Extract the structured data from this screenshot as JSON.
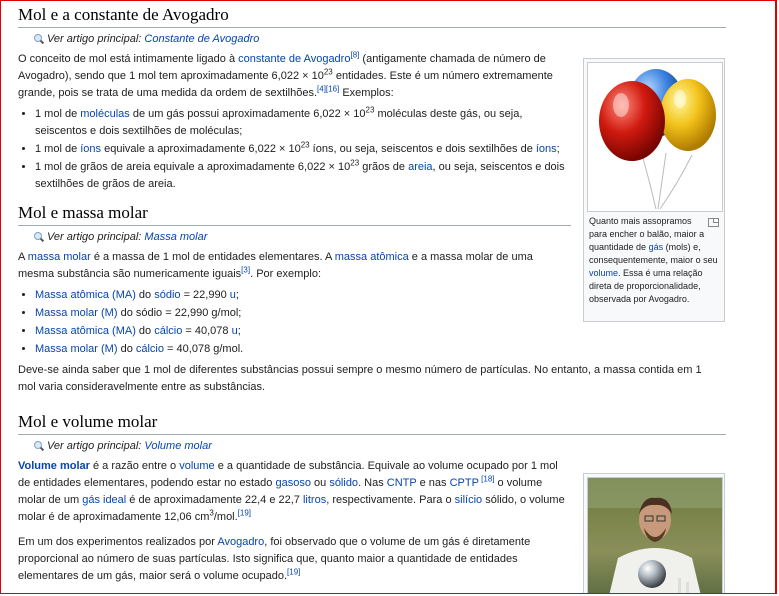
{
  "section1": {
    "heading": "Mol e a constante de Avogadro",
    "hatnote_prefix": "Ver artigo principal: ",
    "hatnote_link": "Constante de Avogadro",
    "p1_a": "O conceito de mol está intimamente ligado à ",
    "p1_link": "constante de Avogadro",
    "p1_ref": "[8]",
    "p1_b": " (antigamente chamada de número de Avogadro), sendo que 1 mol tem aproximadamente 6,022 × 10",
    "p1_exp": "23",
    "p1_c": " entidades. Este é um número extremamente grande, pois se trata de uma medida da ordem de sextilhões.",
    "p1_ref2": "[4][16]",
    "p1_d": " Exemplos:",
    "li1_a": "1 mol de ",
    "li1_link": "moléculas",
    "li1_b": " de um gás possui aproximadamente 6,022 × 10",
    "li1_exp": "23",
    "li1_c": " moléculas deste gás, ou seja, seiscentos e dois sextilhões de moléculas;",
    "li2_a": "1 mol de ",
    "li2_link": "íons",
    "li2_b": " equivale a aproximadamente 6,022 × 10",
    "li2_exp": "23",
    "li2_c": " íons, ou seja, seiscentos e dois sextilhões de ",
    "li2_link2": "íons",
    "li2_d": ";",
    "li3_a": "1 mol de grãos de areia equivale a aproximadamente 6,022 × 10",
    "li3_exp": "23",
    "li3_b": " grãos de ",
    "li3_link": "areia",
    "li3_c": ", ou seja, seiscentos e dois sextilhões de grãos de areia."
  },
  "thumb1": {
    "cap_a": "Quanto mais assopramos para encher o balão, maior a quantidade de ",
    "cap_link1": "gás",
    "cap_b": " (mols) e, consequentemente, maior o seu ",
    "cap_link2": "volume",
    "cap_c": ". Essa é uma relação direta de proporcionalidade, observada por Avogadro."
  },
  "section2": {
    "heading": "Mol e massa molar",
    "hatnote_prefix": "Ver artigo principal: ",
    "hatnote_link": "Massa molar",
    "p1_a": "A ",
    "p1_link1": "massa molar",
    "p1_b": " é a massa de 1 mol de entidades elementares. A ",
    "p1_link2": "massa atômica",
    "p1_c": " e a massa molar de uma mesma substância são numericamente iguais",
    "p1_ref": "[3]",
    "p1_d": ". Por exemplo:",
    "li1_link1": "Massa atômica (MA)",
    "li1_a": " do ",
    "li1_link2": "sódio",
    "li1_b": " = 22,990 ",
    "li1_link3": "u",
    "li1_c": ";",
    "li2_link1": "Massa molar (M)",
    "li2_a": " do sódio = 22,990 g/mol;",
    "li3_link1": "Massa atômica (MA)",
    "li3_a": " do ",
    "li3_link2": "cálcio",
    "li3_b": " = 40,078 ",
    "li3_link3": "u",
    "li3_c": ";",
    "li4_link1": "Massa molar (M)",
    "li4_a": " do ",
    "li4_link2": "cálcio",
    "li4_b": " = 40,078 g/mol.",
    "p2": "Deve-se ainda saber que 1 mol de diferentes substâncias possui sempre o mesmo número de partículas. No entanto, a massa contida em 1 mol varia consideravelmente entre as substâncias."
  },
  "section3": {
    "heading": "Mol e volume molar",
    "hatnote_prefix": "Ver artigo principal: ",
    "hatnote_link": "Volume molar",
    "p1_link1": "Volume molar",
    "p1_a": " é a razão entre o ",
    "p1_link2": "volume",
    "p1_b": " e a quantidade de substância. Equivale ao volume ocupado por 1 mol de entidades elementares, podendo estar no estado ",
    "p1_link3": "gasoso",
    "p1_c": " ou ",
    "p1_link4": "sólido",
    "p1_d": ". Nas ",
    "p1_link5": "CNTP",
    "p1_e": " e nas ",
    "p1_link6": "CPTP",
    "p1_ref": " [18]",
    "p1_f": " o volume molar de um ",
    "p1_link7": "gás ideal",
    "p1_g": " é de aproximadamente 22,4 e 22,7 ",
    "p1_link8": "litros",
    "p1_h": ", respectivamente. Para o ",
    "p1_link9": "silício",
    "p1_i": " sólido, o volume molar é de aproximadamente 12,06 cm",
    "p1_exp": "3",
    "p1_j": "/mol.",
    "p1_ref2": "[19]",
    "p2_a": "Em um dos experimentos realizados por ",
    "p2_link": "Avogadro",
    "p2_b": ", foi observado que o volume de um gás é diretamente proporcional ao número de suas partículas. Isto significa que, quanto maior a quantidade de entidades elementares de um gás, maior será o volume ocupado.",
    "p2_ref": "[19]"
  },
  "colors": {
    "link": "#0645ad",
    "border_red": "#e00000"
  }
}
